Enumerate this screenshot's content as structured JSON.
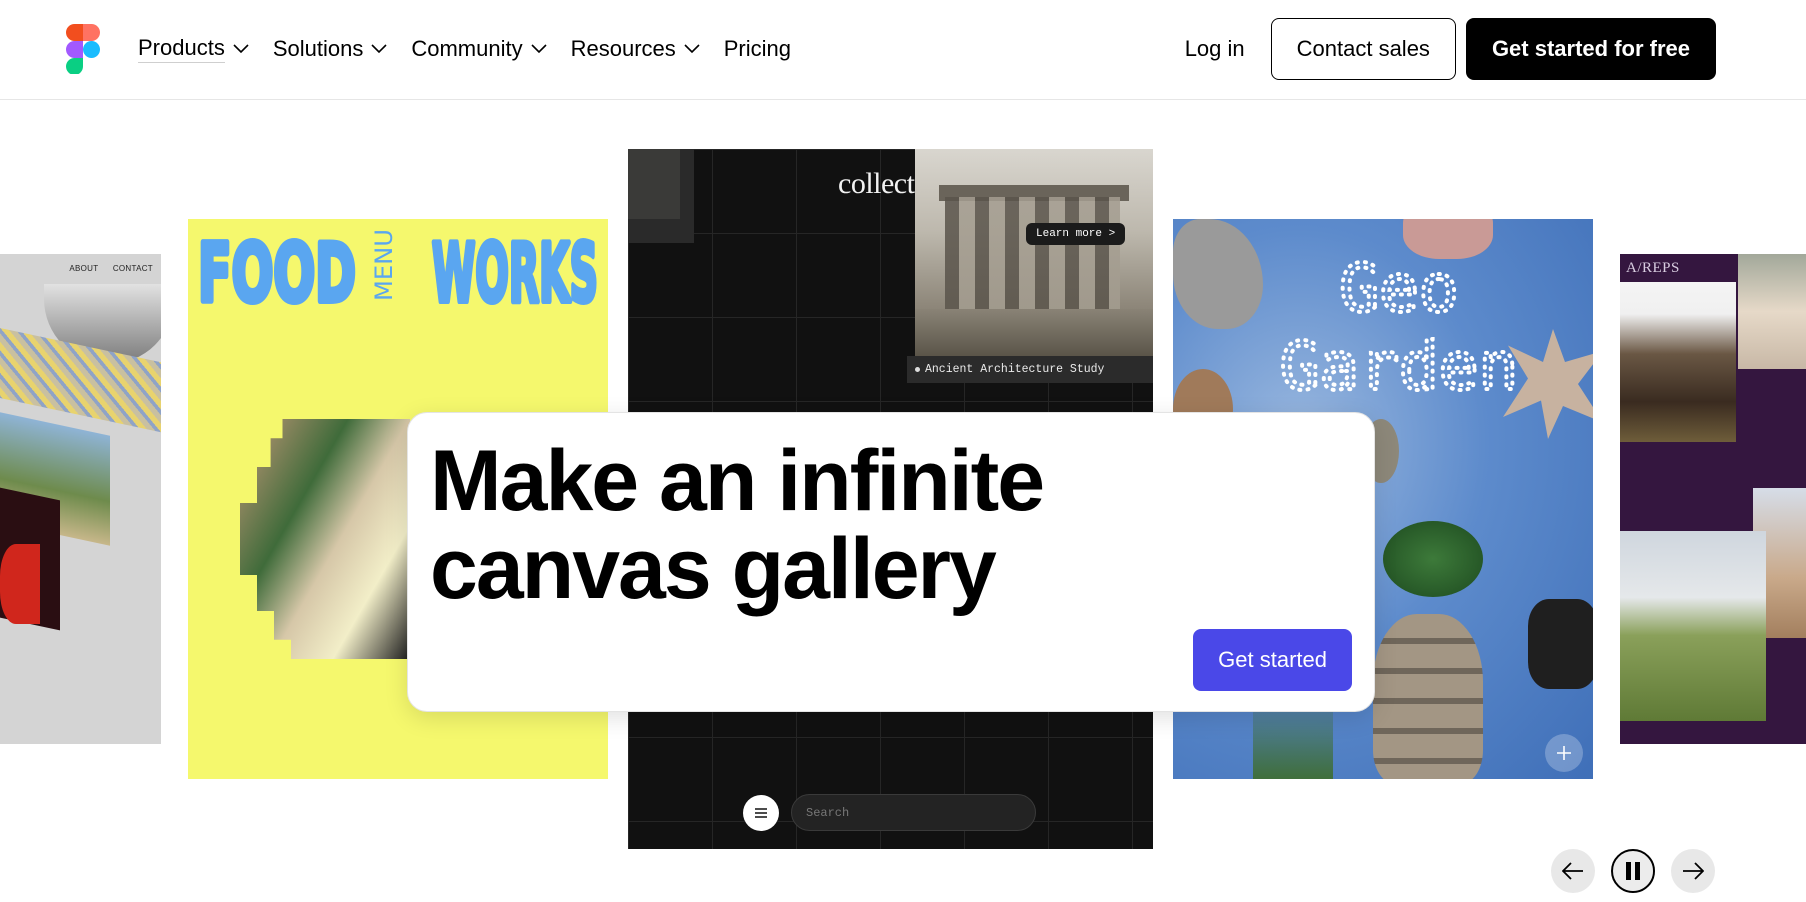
{
  "nav": {
    "logo_icon": "figma-logo-icon",
    "items": [
      {
        "label": "Products",
        "has_dropdown": true
      },
      {
        "label": "Solutions",
        "has_dropdown": true
      },
      {
        "label": "Community",
        "has_dropdown": true
      },
      {
        "label": "Resources",
        "has_dropdown": true
      },
      {
        "label": "Pricing",
        "has_dropdown": false
      }
    ],
    "login": "Log in",
    "contact_sales": "Contact sales",
    "get_started_free": "Get started for free"
  },
  "gallery": {
    "left_card": {
      "nav_links": [
        "ABOUT",
        "CONTACT"
      ]
    },
    "food_works": {
      "title_left": "FOOD",
      "title_middle": "MENU",
      "title_right": "WORKS",
      "color": "#f5f86d",
      "accent": "#5aa6f0"
    },
    "collectiv": {
      "logo": "collectiv",
      "learn_more": "Learn more >",
      "caption": "Ancient Architecture Study",
      "search_placeholder": "Search"
    },
    "geo_garden": {
      "title_line1": "Geo",
      "title_line2": "Garden"
    },
    "reps": {
      "label": "A/REPS"
    }
  },
  "hero": {
    "title": "Make an infinite canvas gallery",
    "cta": "Get started",
    "cta_color": "#4a48e8"
  },
  "carousel": {
    "controls": [
      "arrow-left-icon",
      "pause-icon",
      "arrow-right-icon"
    ]
  }
}
